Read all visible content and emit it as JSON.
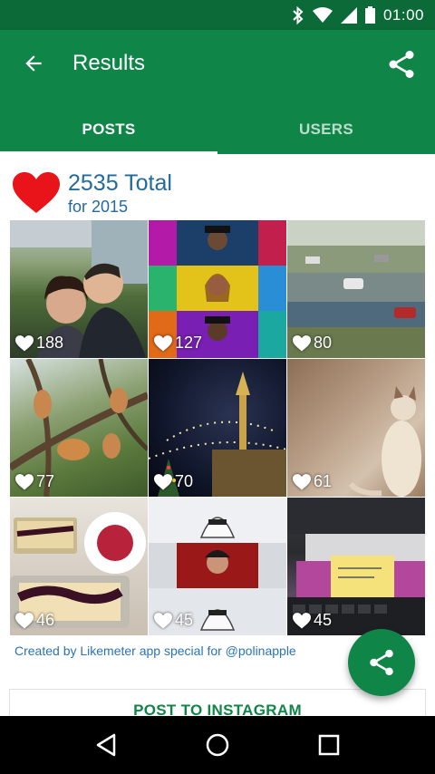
{
  "status_bar": {
    "time": "01:00",
    "icons": [
      "bluetooth-icon",
      "wifi-icon",
      "cell-signal-icon",
      "battery-icon"
    ]
  },
  "app_bar": {
    "title": "Results",
    "back_icon": "arrow-back-icon",
    "share_icon": "share-icon",
    "color": "#0f8547"
  },
  "tabs": [
    {
      "label": "POSTS",
      "active": true
    },
    {
      "label": "USERS",
      "active": false
    }
  ],
  "summary": {
    "total": "2535 Total",
    "year": "for 2015",
    "icon": "heart-icon",
    "heart_color": "#e8141a"
  },
  "posts": [
    {
      "likes": "188",
      "subject": "couple selfie"
    },
    {
      "likes": "127",
      "subject": "video grid"
    },
    {
      "likes": "80",
      "subject": "street"
    },
    {
      "likes": "77",
      "subject": "cats in tree"
    },
    {
      "likes": "70",
      "subject": "night city"
    },
    {
      "likes": "61",
      "subject": "cat"
    },
    {
      "likes": "46",
      "subject": "cakes"
    },
    {
      "likes": "45",
      "subject": "stormtroopers"
    },
    {
      "likes": "45",
      "subject": "desk note"
    }
  ],
  "credit": "Created by Likemeter app special for @polinapple",
  "fab_icon": "share-icon",
  "post_button": "POST TO INSTAGRAM",
  "nav_bar": {
    "back_icon": "nav-back-icon",
    "home_icon": "nav-home-icon",
    "recents_icon": "nav-recents-icon"
  }
}
